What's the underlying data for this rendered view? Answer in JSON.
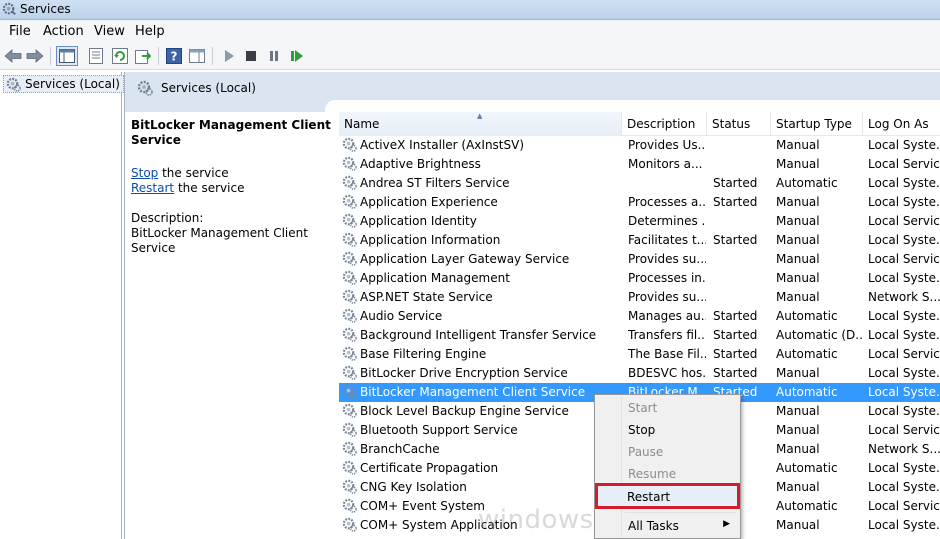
{
  "window": {
    "title": "Services"
  },
  "menu": [
    "File",
    "Action",
    "View",
    "Help"
  ],
  "toolbar": {
    "icons": [
      "back-arrow-icon",
      "forward-arrow-icon",
      "show-hide-console-tree-icon",
      "properties-icon",
      "refresh-icon",
      "export-list-icon",
      "help-icon",
      "show-action-pane-icon",
      "start-service-icon",
      "stop-service-icon",
      "pause-service-icon",
      "restart-service-icon"
    ]
  },
  "tree": {
    "root_label": "Services (Local)"
  },
  "header": {
    "title": "Services (Local)"
  },
  "detail": {
    "service_name": "BitLocker Management Client Service",
    "stop_link": "Stop",
    "stop_suffix": " the service",
    "restart_link": "Restart",
    "restart_suffix": " the service",
    "description_label": "Description:",
    "description_text": "BitLocker Management Client Service"
  },
  "columns": [
    "Name",
    "Description",
    "Status",
    "Startup Type",
    "Log On As"
  ],
  "rows": [
    {
      "name": "ActiveX Installer (AxInstSV)",
      "description": "Provides Us...",
      "status": "",
      "startup": "Manual",
      "logon": "Local Syste..."
    },
    {
      "name": "Adaptive Brightness",
      "description": "Monitors a...",
      "status": "",
      "startup": "Manual",
      "logon": "Local Service"
    },
    {
      "name": "Andrea ST Filters Service",
      "description": "",
      "status": "Started",
      "startup": "Automatic",
      "logon": "Local Syste..."
    },
    {
      "name": "Application Experience",
      "description": "Processes a...",
      "status": "Started",
      "startup": "Manual",
      "logon": "Local Syste..."
    },
    {
      "name": "Application Identity",
      "description": "Determines ...",
      "status": "",
      "startup": "Manual",
      "logon": "Local Service"
    },
    {
      "name": "Application Information",
      "description": "Facilitates t...",
      "status": "Started",
      "startup": "Manual",
      "logon": "Local Syste..."
    },
    {
      "name": "Application Layer Gateway Service",
      "description": "Provides su...",
      "status": "",
      "startup": "Manual",
      "logon": "Local Service"
    },
    {
      "name": "Application Management",
      "description": "Processes in...",
      "status": "",
      "startup": "Manual",
      "logon": "Local Syste..."
    },
    {
      "name": "ASP.NET State Service",
      "description": "Provides su...",
      "status": "",
      "startup": "Manual",
      "logon": "Network S..."
    },
    {
      "name": "Audio Service",
      "description": "Manages au...",
      "status": "Started",
      "startup": "Automatic",
      "logon": "Local Syste..."
    },
    {
      "name": "Background Intelligent Transfer Service",
      "description": "Transfers fil...",
      "status": "Started",
      "startup": "Automatic (D...",
      "logon": "Local Syste..."
    },
    {
      "name": "Base Filtering Engine",
      "description": "The Base Fil...",
      "status": "Started",
      "startup": "Automatic",
      "logon": "Local Service"
    },
    {
      "name": "BitLocker Drive Encryption Service",
      "description": "BDESVC hos...",
      "status": "Started",
      "startup": "Manual",
      "logon": "Local Syste..."
    },
    {
      "name": "BitLocker Management Client Service",
      "description": "BitLocker M...",
      "status": "Started",
      "startup": "Automatic",
      "logon": "Local Syste..."
    },
    {
      "name": "Block Level Backup Engine Service",
      "description": "",
      "status": "",
      "startup": "Manual",
      "logon": "Local Syste..."
    },
    {
      "name": "Bluetooth Support Service",
      "description": "",
      "status": "ed",
      "startup": "Manual",
      "logon": "Local Service"
    },
    {
      "name": "BranchCache",
      "description": "",
      "status": "",
      "startup": "Manual",
      "logon": "Network S..."
    },
    {
      "name": "Certificate Propagation",
      "description": "",
      "status": "ed",
      "startup": "Automatic",
      "logon": "Local Syste..."
    },
    {
      "name": "CNG Key Isolation",
      "description": "",
      "status": "ed",
      "startup": "Manual",
      "logon": "Local Syste..."
    },
    {
      "name": "COM+ Event System",
      "description": "",
      "status": "ed",
      "startup": "Automatic",
      "logon": "Local Service"
    },
    {
      "name": "COM+ System Application",
      "description": "",
      "status": "",
      "startup": "Manual",
      "logon": "Local Syste..."
    }
  ],
  "context_menu": {
    "items": [
      {
        "label": "Start",
        "disabled": true
      },
      {
        "label": "Stop",
        "disabled": false
      },
      {
        "label": "Pause",
        "disabled": true
      },
      {
        "label": "Resume",
        "disabled": true
      },
      {
        "label": "Restart",
        "disabled": false,
        "highlighted": true
      },
      {
        "label": "All Tasks",
        "disabled": false,
        "submenu": true
      }
    ],
    "highlight_color": "#d51c2a"
  },
  "watermark": "windowsnoob.com",
  "colors": {
    "selection": "#3399ff",
    "link": "#0a4ea8",
    "header_band": "#dbe5f1"
  }
}
